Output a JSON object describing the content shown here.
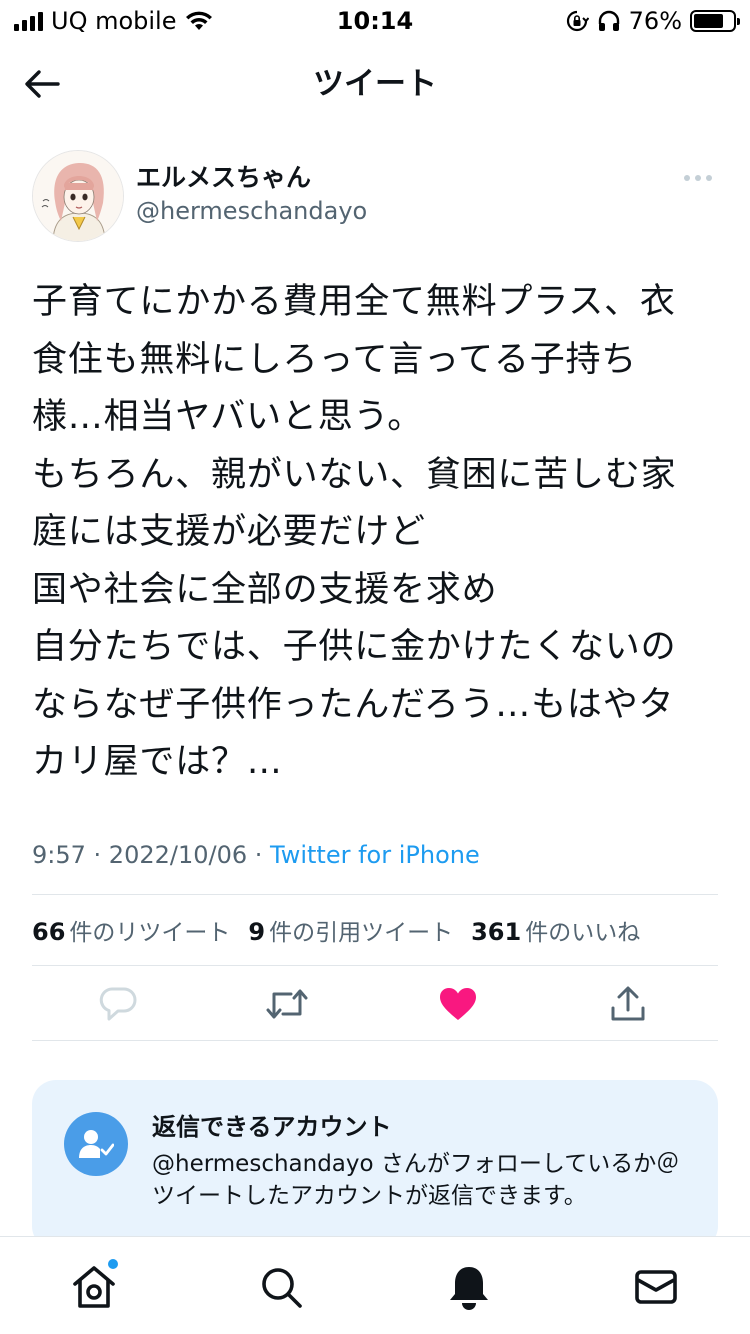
{
  "status_bar": {
    "carrier": "UQ mobile",
    "time": "10:14",
    "battery_percent": "76%",
    "battery_level": 0.76
  },
  "header": {
    "title": "ツイート"
  },
  "author": {
    "display_name": "エルメスちゃん",
    "handle": "@hermeschandayo"
  },
  "tweet": {
    "lines": [
      "子育てにかかる費用全て無料プラス、衣",
      "食住も無料にしろって言ってる子持ち",
      "様…相当ヤバいと思う。",
      "もちろん、親がいない、貧困に苦しむ家",
      "庭には支援が必要だけど",
      "国や社会に全部の支援を求め",
      "自分たちでは、子供に金かけたくないの",
      "ならなぜ子供作ったんだろう…もはやタ",
      "カリ屋では？…"
    ],
    "time": "9:57",
    "separator": " · ",
    "date": "2022/10/06",
    "source": "Twitter for iPhone"
  },
  "stats": {
    "retweets_count": "66",
    "retweets_label": "件のリツイート",
    "quotes_count": "9",
    "quotes_label": "件の引用ツイート",
    "likes_count": "361",
    "likes_label": "件のいいね"
  },
  "actions": {
    "reply_icon": "speech-bubble-icon",
    "retweet_icon": "retweet-icon",
    "like_icon": "heart-icon",
    "share_icon": "share-icon",
    "liked": true,
    "like_color": "#f91880"
  },
  "reply_restriction": {
    "title": "返信できるアカウント",
    "description": "@hermeschandayo さんがフォローしているか＠ツイートしたアカウントが返信できます。",
    "icon": "person-check-icon",
    "icon_color": "#4a9de8",
    "background": "#e8f3fd"
  },
  "tabbar": {
    "items": [
      {
        "name": "home",
        "icon": "home-icon",
        "has_badge": true
      },
      {
        "name": "search",
        "icon": "search-icon"
      },
      {
        "name": "notifications",
        "icon": "bell-icon"
      },
      {
        "name": "messages",
        "icon": "envelope-icon"
      }
    ],
    "badge_color": "#1d9bf0"
  },
  "colors": {
    "accent": "#1d9bf0",
    "text": "#0f1419",
    "secondary_text": "#536471"
  }
}
